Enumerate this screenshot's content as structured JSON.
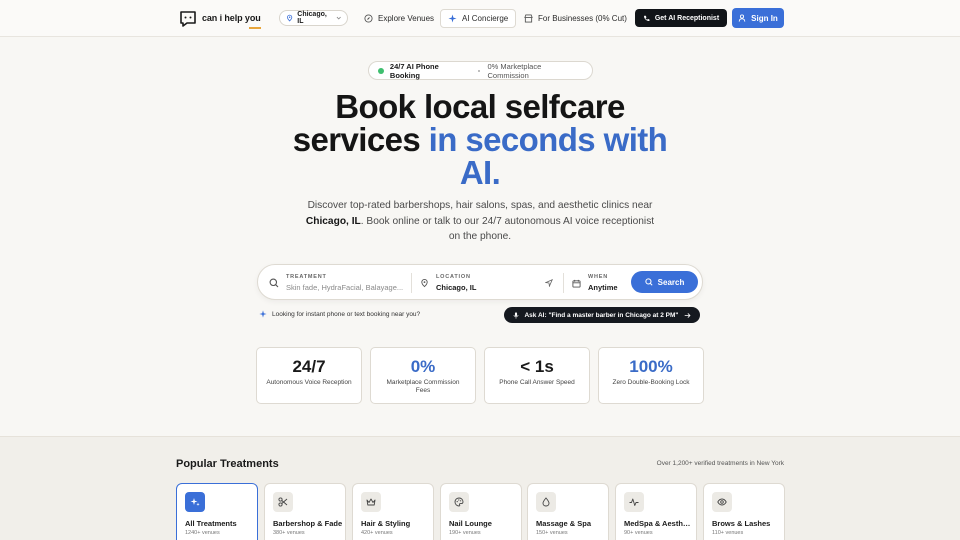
{
  "nav": {
    "logo_text": "can i help you",
    "location": "Chicago, IL",
    "links": [
      {
        "label": "Explore Venues",
        "icon": "compass-icon"
      },
      {
        "label": "AI Concierge",
        "icon": "sparkle-icon"
      },
      {
        "label": "For Businesses (0% Cut)",
        "icon": "store-icon"
      }
    ],
    "cta_receptionist": "Get AI Receptionist",
    "cta_signin": "Sign In"
  },
  "hero": {
    "badge_primary": "24/7 AI Phone Booking",
    "badge_secondary": "0% Marketplace Commission",
    "title_line1": "Book local selfcare",
    "title_line2_plain": "services ",
    "title_line2_accent": "in seconds with",
    "title_line3_accent": "AI.",
    "subtitle_pre": "Discover top-rated barbershops, hair salons, spas, and aesthetic clinics near ",
    "subtitle_city": "Chicago, IL",
    "subtitle_post": ". Book online or talk to our 24/7 autonomous AI voice receptionist on the phone."
  },
  "search": {
    "treatment_label": "TREATMENT",
    "treatment_placeholder": "Skin fade, HydraFacial, Balayage...",
    "location_label": "LOCATION",
    "location_value": "Chicago, IL",
    "when_label": "WHEN",
    "when_value": "Anytime",
    "button": "Search"
  },
  "hint": {
    "text": "Looking for instant phone or text booking near you?",
    "ask_ai": "Ask AI: \"Find a master barber in Chicago at 2 PM\""
  },
  "stats": [
    {
      "value": "24/7",
      "label": "Autonomous Voice Reception",
      "accent": false
    },
    {
      "value": "0%",
      "label": "Marketplace Commission Fees",
      "accent": true
    },
    {
      "value": "< 1s",
      "label": "Phone Call Answer Speed",
      "accent": false
    },
    {
      "value": "100%",
      "label": "Zero Double-Booking Lock",
      "accent": true
    }
  ],
  "treatments": {
    "title": "Popular Treatments",
    "note": "Over 1,200+ verified treatments in New York",
    "items": [
      {
        "name": "All Treatments",
        "count": "1240+ venues",
        "icon": "sparkle-icon"
      },
      {
        "name": "Barbershop & Fade",
        "count": "380+ venues",
        "icon": "scissors-icon"
      },
      {
        "name": "Hair & Styling",
        "count": "420+ venues",
        "icon": "crown-icon"
      },
      {
        "name": "Nail Lounge",
        "count": "190+ venues",
        "icon": "palette-icon"
      },
      {
        "name": "Massage & Spa",
        "count": "150+ venues",
        "icon": "drop-icon"
      },
      {
        "name": "MedSpa & Aesthetics",
        "count": "90+ venues",
        "icon": "pulse-icon"
      },
      {
        "name": "Brows & Lashes",
        "count": "110+ venues",
        "icon": "eye-icon"
      }
    ]
  },
  "colors": {
    "accent": "#3a6fd8",
    "dark": "#111418",
    "brand_underline": "#e8a53a",
    "live_dot": "#3fbf6f"
  }
}
